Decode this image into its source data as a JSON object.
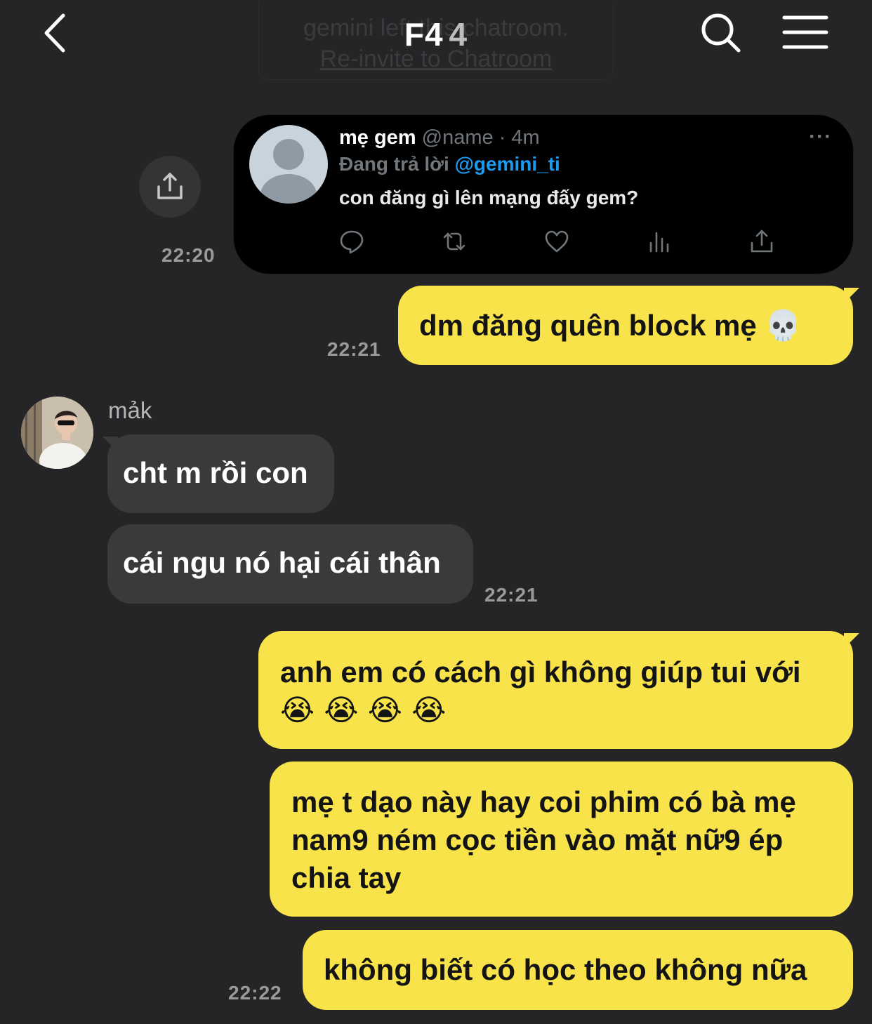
{
  "header": {
    "title": "F4",
    "member_count": "4",
    "system_notice": "gemini left this chatroom.",
    "reinvite_link": "Re-invite to Chatroom"
  },
  "tweet": {
    "author": "mẹ gem",
    "handle": "@name · 4m",
    "reply_prefix": "Đang trả lời",
    "reply_to": "@gemini_ti",
    "text": "con đăng gì lên mạng đấy gem?",
    "more": "···",
    "time": "22:20"
  },
  "messages": {
    "m1": {
      "text": "dm đăng quên block mẹ",
      "emoji": "💀",
      "time": "22:21"
    },
    "sender": {
      "name": "mảk"
    },
    "r1": {
      "text": "cht m rồi con"
    },
    "r2": {
      "text": "cái ngu nó hại cái thân",
      "time": "22:21"
    },
    "m2": {
      "text": "anh em có cách gì không giúp tui với",
      "emoji": "😭 😭 😭 😭"
    },
    "m3": {
      "line1": "mẹ t dạo này hay coi phim có bà mẹ",
      "line2": "nam9 ném cọc tiền vào mặt nữ9 ép",
      "line3": "chia tay"
    },
    "m4": {
      "text": "không biết có học theo không nữa",
      "time": "22:22"
    }
  },
  "colors": {
    "background": "#252527",
    "my_bubble": "#f8e34a",
    "their_bubble": "#3a3a3d",
    "mention": "#1d9bf0"
  }
}
